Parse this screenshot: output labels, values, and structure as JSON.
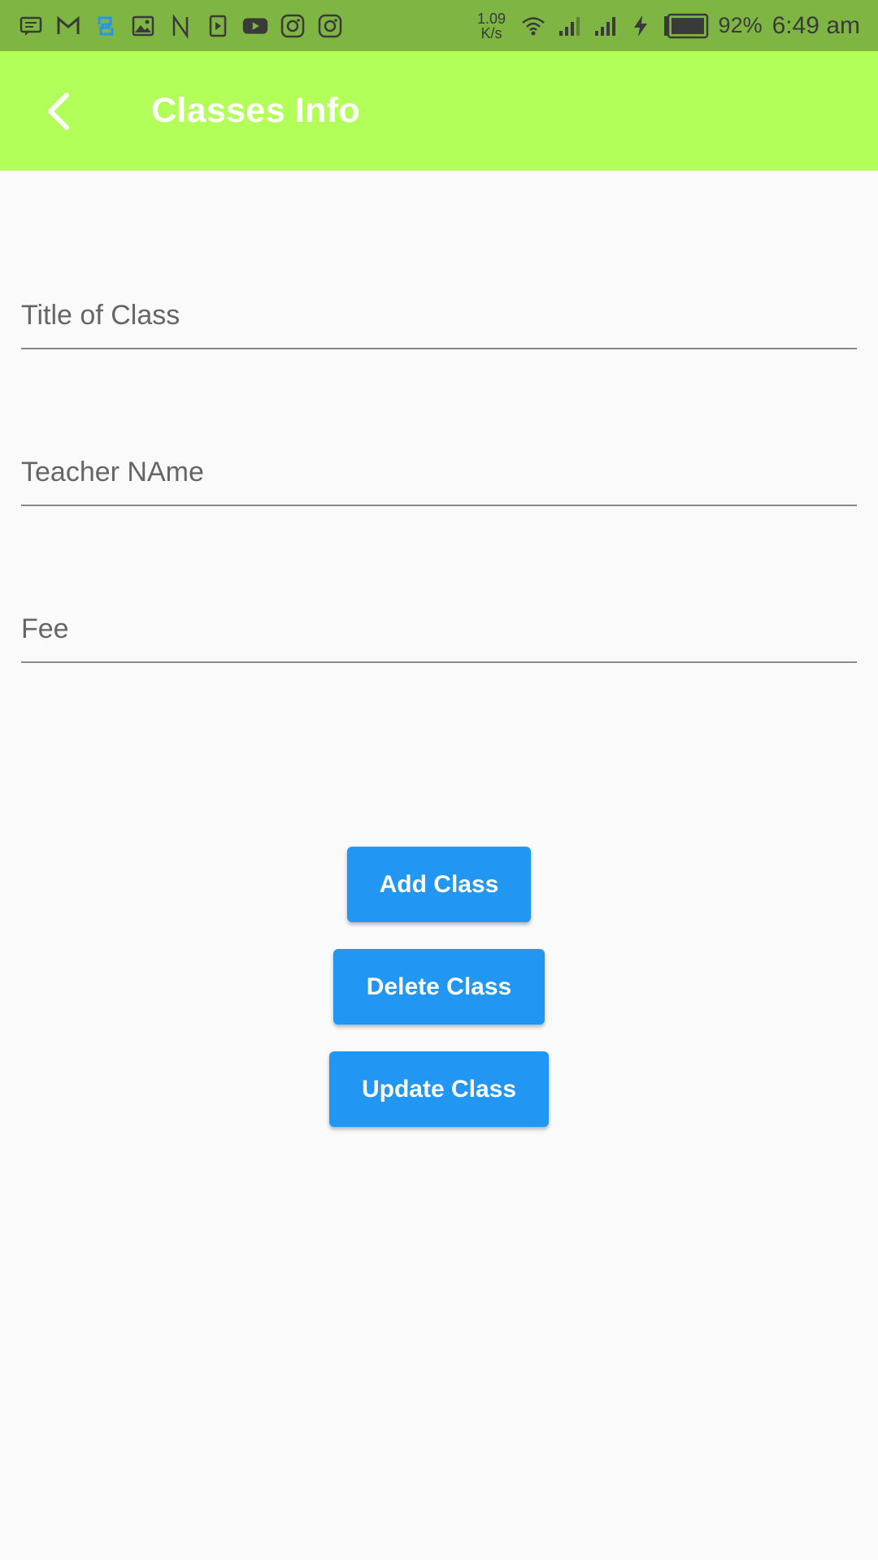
{
  "colors": {
    "status_bar": "#7fb542",
    "app_bar": "#b2ff59",
    "background": "#fafafa",
    "button": "#2196f3",
    "sync_icon": "#2196f3"
  },
  "status_bar": {
    "left_icons": [
      "message-icon",
      "gmail-icon",
      "sync-icon",
      "gallery-icon",
      "n-icon",
      "media-play-icon",
      "youtube-icon",
      "instagram-icon",
      "instagram-icon"
    ],
    "speed_value": "1.09",
    "speed_unit": "K/s",
    "battery_percent": "92%",
    "time": "6:49 am"
  },
  "app_bar": {
    "title": "Classes Info",
    "back_icon": "chevron-left-icon"
  },
  "form": {
    "title_placeholder": "Title of Class",
    "title_value": "",
    "teacher_placeholder": "Teacher NAme",
    "teacher_value": "",
    "fee_placeholder": "Fee",
    "fee_value": ""
  },
  "buttons": {
    "add": "Add Class",
    "delete": "Delete Class",
    "update": "Update Class"
  }
}
